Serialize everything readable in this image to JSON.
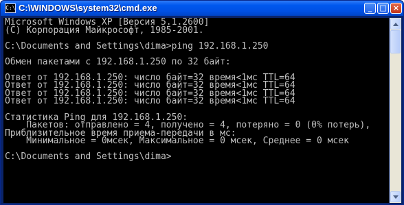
{
  "window": {
    "title": "C:\\WINDOWS\\system32\\cmd.exe",
    "icon": "cmd-icon",
    "controls": {
      "minimize": "_",
      "maximize": "□",
      "close": "×"
    }
  },
  "console": {
    "lines": [
      "Microsoft Windows XP [Версия 5.1.2600]",
      "(С) Корпорация Майкрософт, 1985-2001.",
      "",
      "C:\\Documents and Settings\\dima>ping 192.168.1.250",
      "",
      "Обмен пакетами с 192.168.1.250 по 32 байт:",
      "",
      "Ответ от 192.168.1.250: число байт=32 время<1мс TTL=64",
      "Ответ от 192.168.1.250: число байт=32 время<1мс TTL=64",
      "Ответ от 192.168.1.250: число байт=32 время<1мс TTL=64",
      "Ответ от 192.168.1.250: число байт=32 время<1мс TTL=64",
      "",
      "Статистика Ping для 192.168.1.250:",
      "    Пакетов: отправлено = 4, получено = 4, потеряно = 0 (0% потерь),",
      "Приблизительное время приема-передачи в мс:",
      "    Минимальное = 0мсек, Максимальное = 0 мсек, Среднее = 0 мсек",
      "",
      "C:\\Documents and Settings\\dima>"
    ]
  }
}
